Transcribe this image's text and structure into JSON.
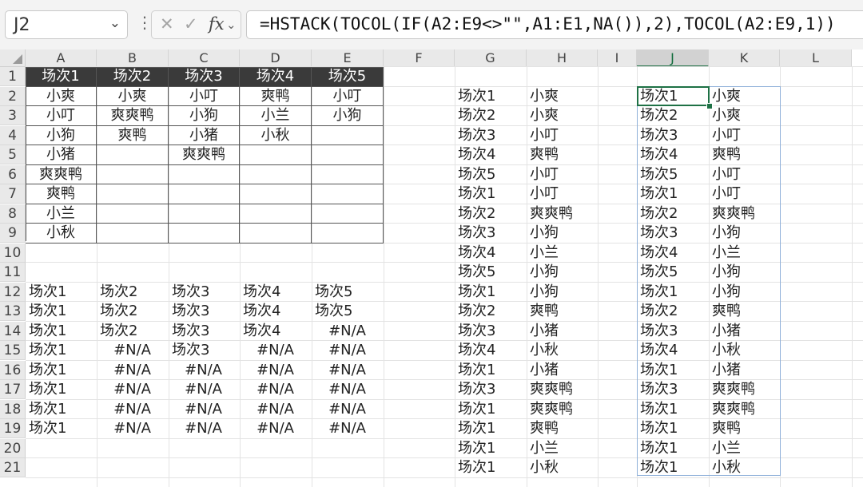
{
  "name_box": "J2",
  "formula": "=HSTACK(TOCOL(IF(A2:E9<>\"\",A1:E1,NA()),2),TOCOL(A2:E9,1))",
  "fx_label": "fx",
  "icons": [
    "chevron-down-icon",
    "more-options-icon",
    "cancel-icon",
    "confirm-icon",
    "function-icon",
    "select-all-icon"
  ],
  "colors": {
    "accent": "#1e7145",
    "header_fill": "#3a3a3a",
    "spill_border": "#8fb0d9"
  },
  "selected_column": "J",
  "columns": [
    "A",
    "B",
    "C",
    "D",
    "E",
    "F",
    "G",
    "H",
    "I",
    "J",
    "K",
    "L"
  ],
  "rows": [
    "1",
    "2",
    "3",
    "4",
    "5",
    "6",
    "7",
    "8",
    "9",
    "10",
    "11",
    "12",
    "13",
    "14",
    "15",
    "16",
    "17",
    "18",
    "19",
    "20",
    "21"
  ],
  "table_header": [
    "场次1",
    "场次2",
    "场次3",
    "场次4",
    "场次5"
  ],
  "table_body": [
    [
      "小爽",
      "小爽",
      "小叮",
      "爽鸭",
      "小叮"
    ],
    [
      "小叮",
      "爽爽鸭",
      "小狗",
      "小兰",
      "小狗"
    ],
    [
      "小狗",
      "爽鸭",
      "小猪",
      "小秋",
      ""
    ],
    [
      "小猪",
      "",
      "爽爽鸭",
      "",
      ""
    ],
    [
      "爽爽鸭",
      "",
      "",
      "",
      ""
    ],
    [
      "爽鸭",
      "",
      "",
      "",
      ""
    ],
    [
      "小兰",
      "",
      "",
      "",
      ""
    ],
    [
      "小秋",
      "",
      "",
      "",
      ""
    ]
  ],
  "na_grid": [
    [
      "场次1",
      "场次2",
      "场次3",
      "场次4",
      "场次5"
    ],
    [
      "场次1",
      "场次2",
      "场次3",
      "场次4",
      "场次5"
    ],
    [
      "场次1",
      "场次2",
      "场次3",
      "场次4",
      "#N/A"
    ],
    [
      "场次1",
      "#N/A",
      "场次3",
      "#N/A",
      "#N/A"
    ],
    [
      "场次1",
      "#N/A",
      "#N/A",
      "#N/A",
      "#N/A"
    ],
    [
      "场次1",
      "#N/A",
      "#N/A",
      "#N/A",
      "#N/A"
    ],
    [
      "场次1",
      "#N/A",
      "#N/A",
      "#N/A",
      "#N/A"
    ],
    [
      "场次1",
      "#N/A",
      "#N/A",
      "#N/A",
      "#N/A"
    ]
  ],
  "gh_list": [
    [
      "场次1",
      "小爽"
    ],
    [
      "场次2",
      "小爽"
    ],
    [
      "场次3",
      "小叮"
    ],
    [
      "场次4",
      "爽鸭"
    ],
    [
      "场次5",
      "小叮"
    ],
    [
      "场次1",
      "小叮"
    ],
    [
      "场次2",
      "爽爽鸭"
    ],
    [
      "场次3",
      "小狗"
    ],
    [
      "场次4",
      "小兰"
    ],
    [
      "场次5",
      "小狗"
    ],
    [
      "场次1",
      "小狗"
    ],
    [
      "场次2",
      "爽鸭"
    ],
    [
      "场次3",
      "小猪"
    ],
    [
      "场次4",
      "小秋"
    ],
    [
      "场次1",
      "小猪"
    ],
    [
      "场次3",
      "爽爽鸭"
    ],
    [
      "场次1",
      "爽爽鸭"
    ],
    [
      "场次1",
      "爽鸭"
    ],
    [
      "场次1",
      "小兰"
    ],
    [
      "场次1",
      "小秋"
    ]
  ],
  "jk_list": [
    [
      "场次1",
      "小爽"
    ],
    [
      "场次2",
      "小爽"
    ],
    [
      "场次3",
      "小叮"
    ],
    [
      "场次4",
      "爽鸭"
    ],
    [
      "场次5",
      "小叮"
    ],
    [
      "场次1",
      "小叮"
    ],
    [
      "场次2",
      "爽爽鸭"
    ],
    [
      "场次3",
      "小狗"
    ],
    [
      "场次4",
      "小兰"
    ],
    [
      "场次5",
      "小狗"
    ],
    [
      "场次1",
      "小狗"
    ],
    [
      "场次2",
      "爽鸭"
    ],
    [
      "场次3",
      "小猪"
    ],
    [
      "场次4",
      "小秋"
    ],
    [
      "场次1",
      "小猪"
    ],
    [
      "场次3",
      "爽爽鸭"
    ],
    [
      "场次1",
      "爽爽鸭"
    ],
    [
      "场次1",
      "爽鸭"
    ],
    [
      "场次1",
      "小兰"
    ],
    [
      "场次1",
      "小秋"
    ]
  ]
}
